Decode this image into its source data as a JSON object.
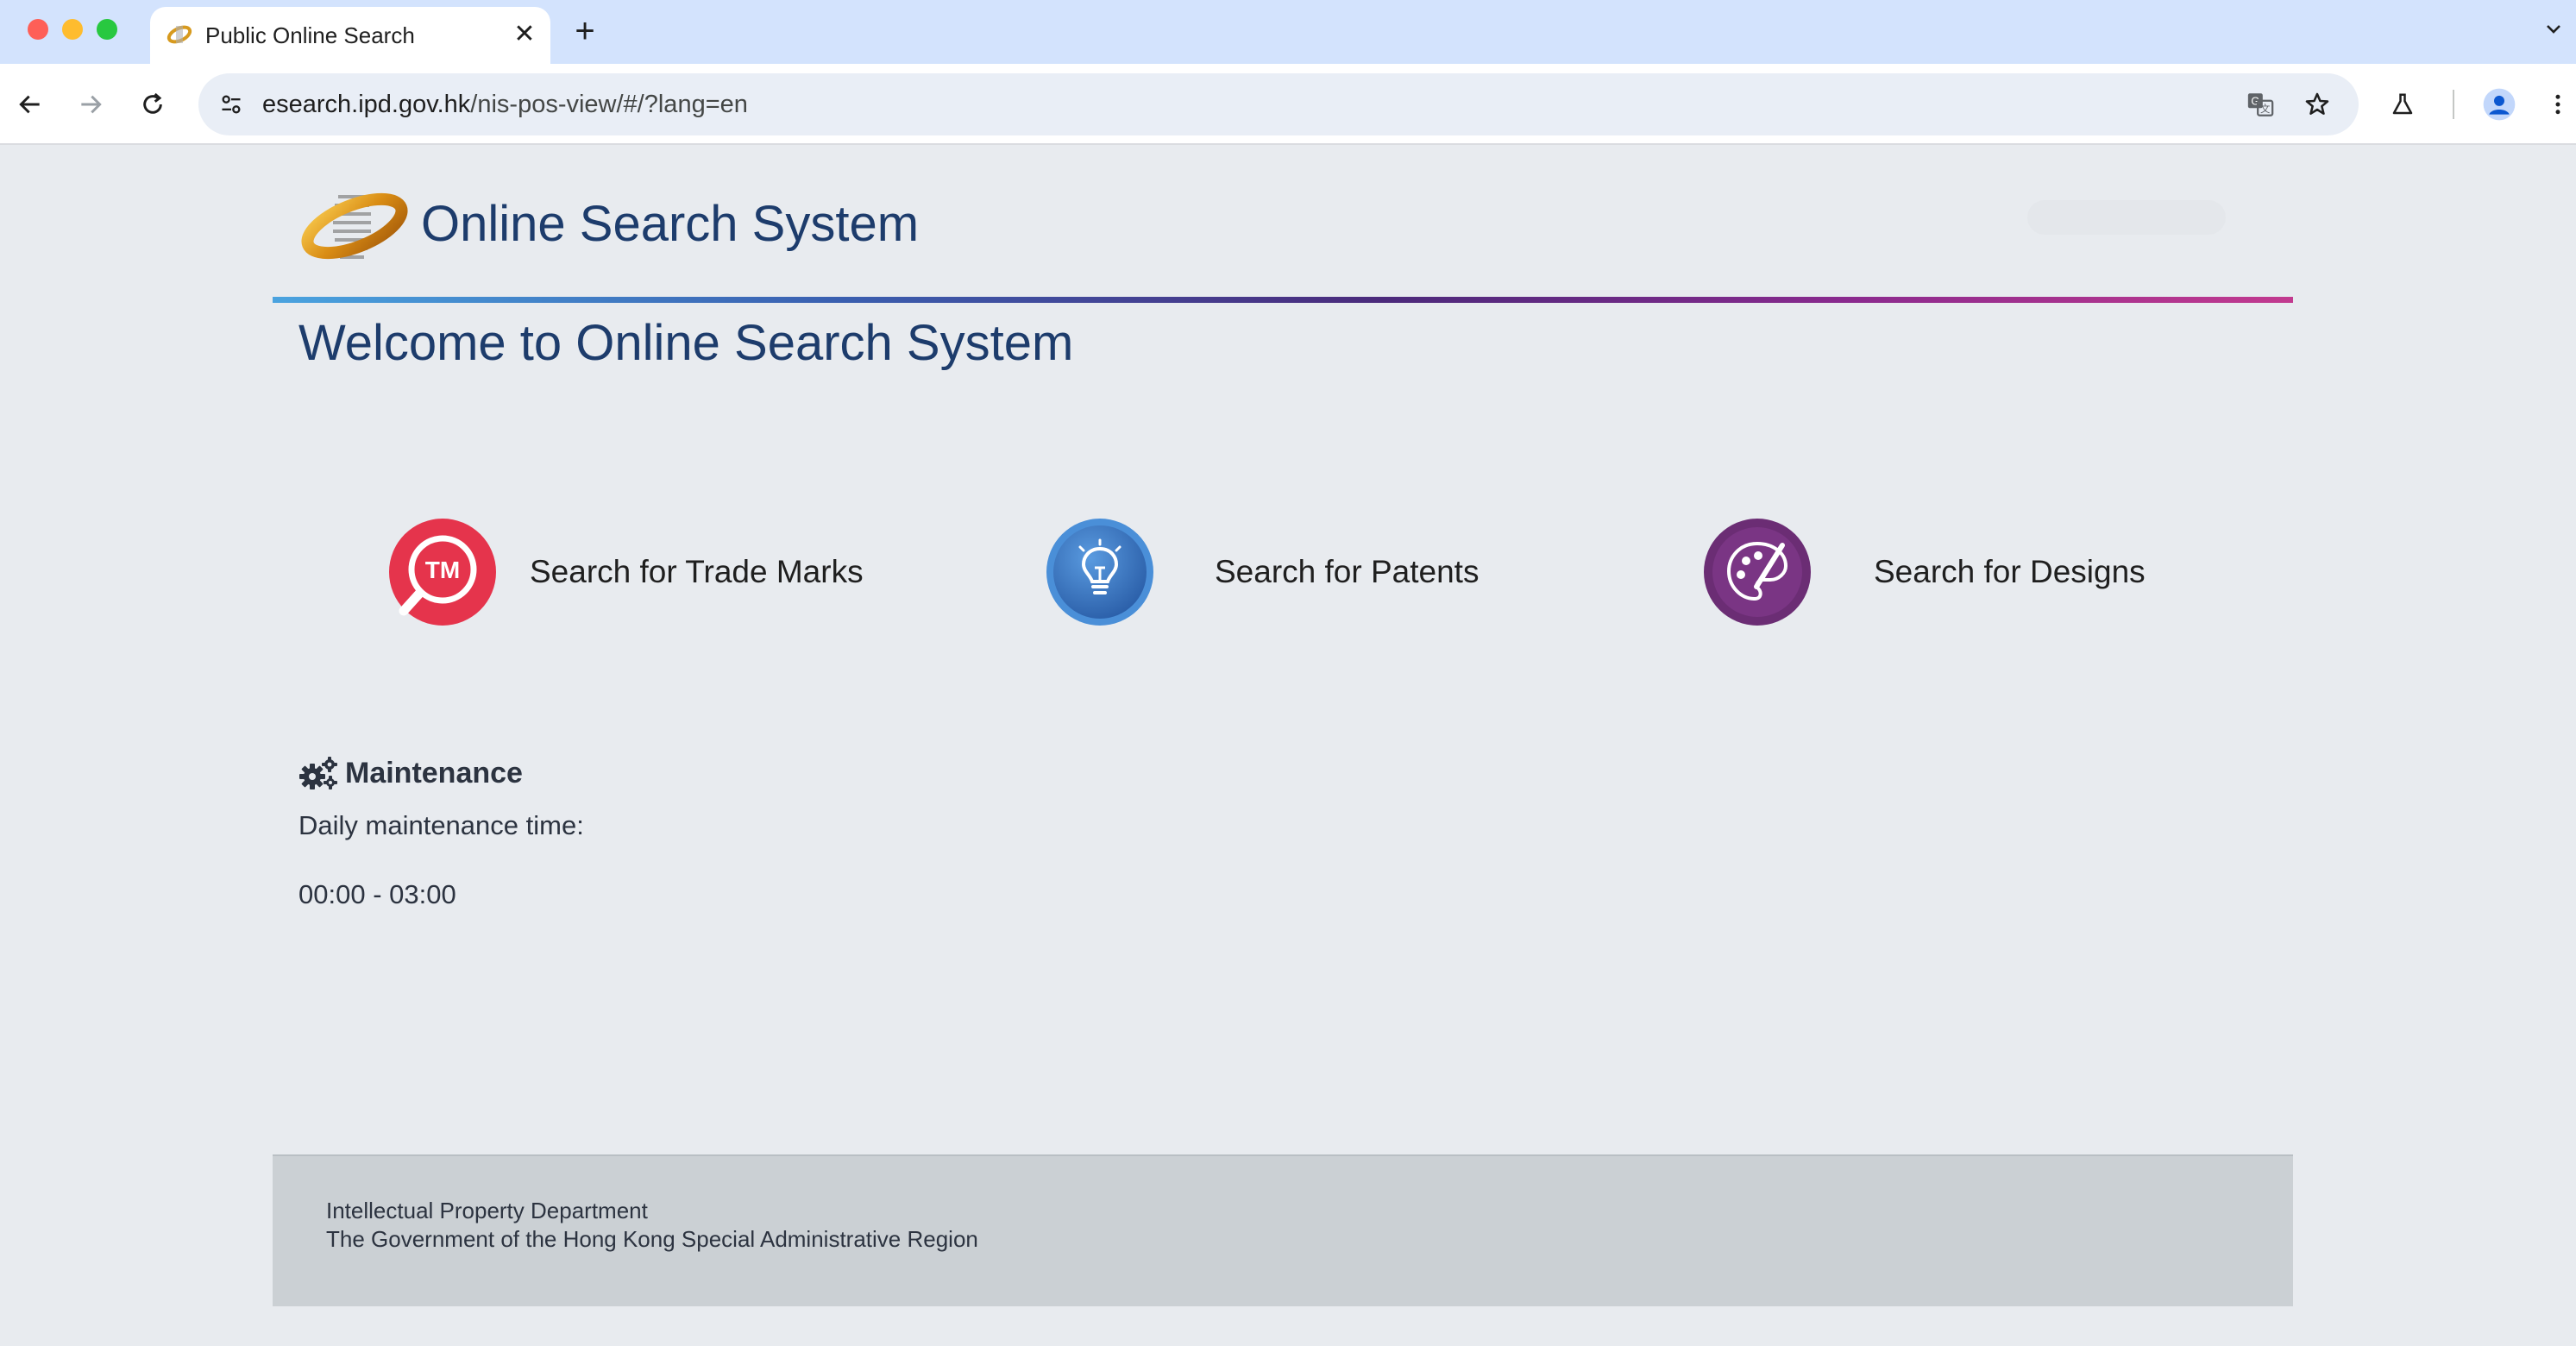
{
  "browser": {
    "tab": {
      "title": "Public Online Search",
      "close_glyph": "✕"
    },
    "new_tab_glyph": "+",
    "url_domain": "esearch.ipd.gov.hk",
    "url_path": "/nis-pos-view/#/?lang=en",
    "icons": [
      "back-arrow-icon",
      "forward-arrow-icon",
      "reload-icon",
      "site-info-icon",
      "translate-icon",
      "bookmark-star-icon",
      "labs-flask-icon",
      "profile-avatar-icon",
      "more-menu-icon",
      "tab-search-chevron-icon"
    ]
  },
  "header": {
    "site_title": "Online Search System",
    "welcome": "Welcome to Online Search System"
  },
  "search_options": [
    {
      "label": "Search for Trade Marks",
      "icon": "trade-mark-search-icon",
      "color": "#e5344c"
    },
    {
      "label": "Search for Patents",
      "icon": "lightbulb-icon",
      "color": "#3c79c7"
    },
    {
      "label": "Search for Designs",
      "icon": "palette-icon",
      "color": "#6b2d74"
    }
  ],
  "maintenance": {
    "title": "Maintenance",
    "line1": "Daily maintenance time:",
    "line2": "00:00 - 03:00"
  },
  "footer": {
    "line1": "Intellectual Property Department",
    "line2": "The Government of the Hong Kong Special Administrative Region"
  },
  "colors": {
    "title": "#1d3c6c",
    "page_bg": "#e8ebef",
    "footer_bg": "#cbd0d4"
  }
}
